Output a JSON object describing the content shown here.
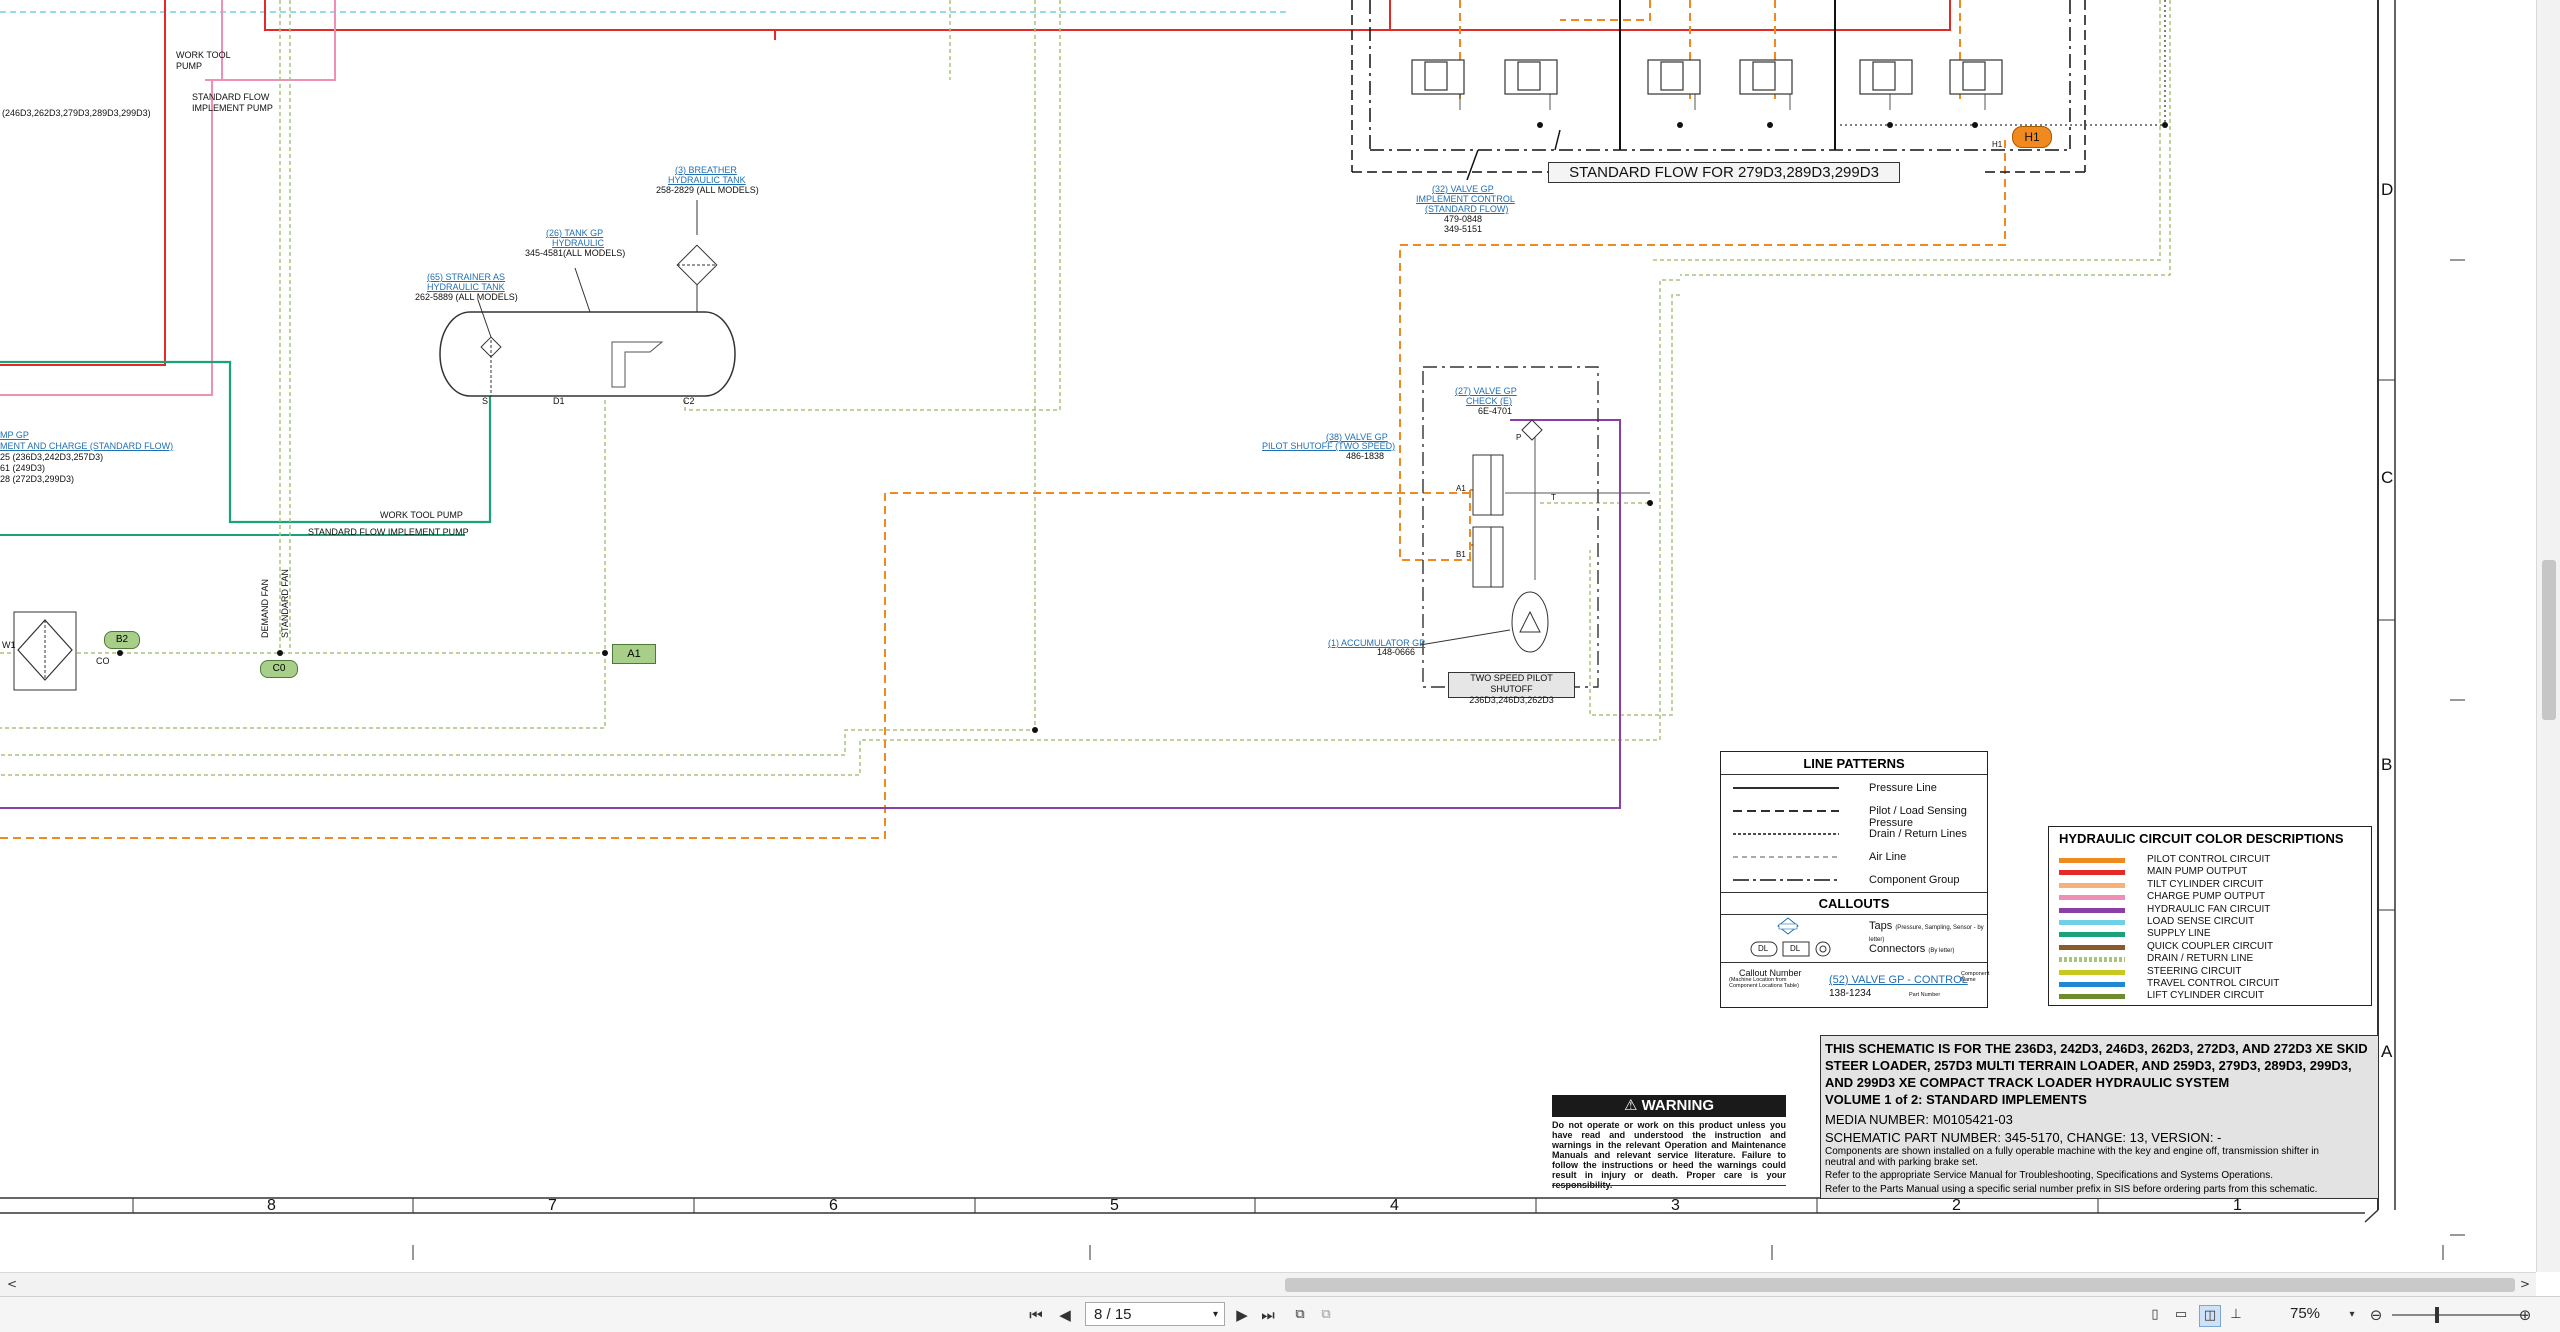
{
  "schematic": {
    "top_labels": {
      "work_tool_pump": "WORK TOOL\nPUMP",
      "standard_flow_pump": "STANDARD FLOW\nIMPLEMENT PUMP",
      "models_246": "(246D3,262D3,279D3,289D3,299D3)",
      "pump_gp_partial": "MP GP",
      "pump_desc_partial": "MENT AND CHARGE (STANDARD FLOW)",
      "pump_models_1": "25 (236D3,242D3,257D3)",
      "pump_models_2": "61 (249D3)",
      "pump_models_3": "28 (272D3,299D3)",
      "work_tool_pump_line": "WORK TOOL PUMP",
      "std_flow_implement_pump_line": "STANDARD FLOW IMPLEMENT PUMP",
      "demand_fan": "DEMAND FAN",
      "standard_fan": "STANDARD FAN"
    },
    "components": {
      "breather_callout": "(3) BREATHER",
      "breather_name": "HYDRAULIC TANK",
      "breather_part": "258-2829 (ALL MODELS)",
      "tank_callout": "(26) TANK GP",
      "tank_name": "HYDRAULIC",
      "tank_part": "345-4581(ALL MODELS)",
      "strainer_callout": "(65) STRAINER AS",
      "strainer_name": "HYDRAULIC TANK",
      "strainer_part": "262-5889 (ALL MODELS)",
      "tank_port_s": "S",
      "tank_port_d1": "D1",
      "tank_port_c2": "C2",
      "valve_control_callout": "(32) VALVE GP",
      "valve_control_name_1": "IMPLEMENT CONTROL",
      "valve_control_name_2": "(STANDARD FLOW)",
      "valve_control_part_1": "479-0848",
      "valve_control_part_2": "349-5151",
      "standard_flow_banner": "STANDARD FLOW FOR 279D3,289D3,299D3",
      "check_valve_callout": "(27) VALVE GP",
      "check_valve_name": "CHECK (E)",
      "check_valve_part": "6E-4701",
      "pilot_shutoff_callout": "(38) VALVE GP",
      "pilot_shutoff_name": "PILOT SHUTOFF (TWO SPEED)",
      "pilot_shutoff_part": "486-1838",
      "accumulator_callout": "(1) ACCUMULATOR GP",
      "accumulator_part": "148-0666",
      "two_speed_box_1": "TWO SPEED PILOT SHUTOFF",
      "two_speed_box_2": "236D3,246D3,262D3",
      "port_a1": "A1",
      "port_b1": "B1",
      "port_t": "T",
      "port_p": "P",
      "h1_tag": "H1",
      "h1_small": "H1",
      "a1_tag": "A1",
      "b2_tag": "B2",
      "c0_tag": "C0",
      "w1": "W1",
      "co": "CO"
    },
    "line_patterns": {
      "title": "LINE PATTERNS",
      "rows": [
        "Pressure Line",
        "Pilot / Load Sensing Pressure",
        "Drain / Return Lines",
        "Air Line",
        "Component Group"
      ],
      "callouts_title": "CALLOUTS",
      "taps_label": "Taps",
      "taps_note": "(Pressure, Sampling, Sensor - by letter)",
      "connectors_label": "Connectors",
      "connectors_note": "(By letter)",
      "conn_icon_1": "DL",
      "conn_icon_2": "DL",
      "callout_number": "Callout Number",
      "callout_number_note": "(Machine Location from Component Locations Table)",
      "example_callout": "(52) VALVE GP - CONTROL",
      "example_part": "138-1234",
      "component_name_note": "Component Name",
      "part_number_note": "Part Number"
    },
    "color_legend": {
      "title": "HYDRAULIC CIRCUIT COLOR DESCRIPTIONS",
      "entries": [
        {
          "label": "PILOT CONTROL CIRCUIT",
          "color": "#f08a1e"
        },
        {
          "label": "MAIN PUMP OUTPUT",
          "color": "#e52828"
        },
        {
          "label": "TILT CYLINDER CIRCUIT",
          "color": "#f6b27a"
        },
        {
          "label": "CHARGE PUMP OUTPUT",
          "color": "#ef8fb5"
        },
        {
          "label": "HYDRAULIC FAN CIRCUIT",
          "color": "#8a3fa6"
        },
        {
          "label": "LOAD SENSE CIRCUIT",
          "color": "#6fd0e8"
        },
        {
          "label": "SUPPLY LINE",
          "color": "#1aa37a"
        },
        {
          "label": "QUICK COUPLER CIRCUIT",
          "color": "#8a5a2b"
        },
        {
          "label": "DRAIN / RETURN LINE",
          "color": "#a8c37a"
        },
        {
          "label": "STEERING CIRCUIT",
          "color": "#c8c81e"
        },
        {
          "label": "TRAVEL CONTROL CIRCUIT",
          "color": "#1e88d6"
        },
        {
          "label": "LIFT CYLINDER CIRCUIT",
          "color": "#6e8c2e"
        }
      ]
    },
    "warning": {
      "title": "WARNING",
      "text": "Do not operate or work on this product unless you have read and understood the instruction and warnings in the relevant Operation and Maintenance Manuals and relevant service literature. Failure to follow the instructions or heed the warnings could result in injury or death. Proper care is your responsibility."
    },
    "title_block": {
      "heading": "THIS SCHEMATIC IS FOR THE 236D3, 242D3, 246D3, 262D3, 272D3, AND 272D3 XE SKID STEER LOADER, 257D3 MULTI TERRAIN LOADER, AND 259D3, 279D3, 289D3, 299D3, AND 299D3 XE COMPACT TRACK LOADER HYDRAULIC SYSTEM",
      "volume": "VOLUME 1 of 2: STANDARD IMPLEMENTS",
      "media": "MEDIA NUMBER: M0105421-03",
      "part": "SCHEMATIC PART NUMBER: 345-5170, CHANGE: 13, VERSION: -",
      "note_1": "Components are shown installed on a fully operable machine with the key and engine off, transmission shifter in neutral and with parking brake set.",
      "note_2": "Refer to the appropriate Service Manual for Troubleshooting, Specifications and Systems Operations.",
      "note_3": "Refer to the Parts Manual using a specific serial number prefix in SIS before ordering parts from this schematic."
    },
    "grid_rows": [
      "D",
      "C",
      "B",
      "A"
    ],
    "grid_cols": [
      "8",
      "7",
      "6",
      "5",
      "4",
      "3",
      "2",
      "1"
    ]
  },
  "viewer": {
    "page_value": "8 / 15",
    "zoom": "75%",
    "first_page_icon": "first-page-icon",
    "prev_page_icon": "prev-page-icon",
    "next_page_icon": "next-page-icon",
    "last_page_icon": "last-page-icon"
  }
}
